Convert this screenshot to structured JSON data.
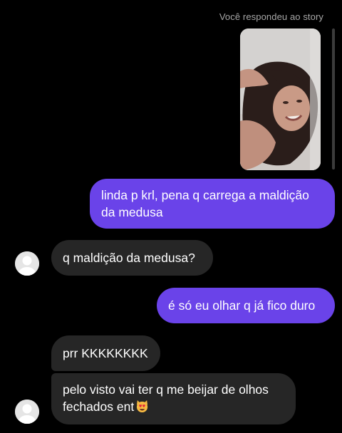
{
  "story": {
    "caption": "Você respondeu ao story",
    "thumbnail": "story-photo"
  },
  "messages": [
    {
      "sender": "me",
      "lines": [
        "linda p krl, pena q carrega a maldição",
        "da medusa"
      ]
    },
    {
      "sender": "them",
      "text": "q maldição da medusa?"
    },
    {
      "sender": "me",
      "text": "é só eu olhar q já fico duro"
    },
    {
      "sender": "them",
      "text": "prr KKKKKKKK"
    },
    {
      "sender": "them",
      "lines": [
        "pelo visto vai ter q me beijar de olhos",
        "fechados ent"
      ],
      "emoji": "heart-eyes-cat-emoji"
    }
  ],
  "colors": {
    "background": "#000000",
    "sent_bubble": "#6a43e9",
    "received_bubble": "#262626",
    "caption_text": "#a8a8a8"
  }
}
